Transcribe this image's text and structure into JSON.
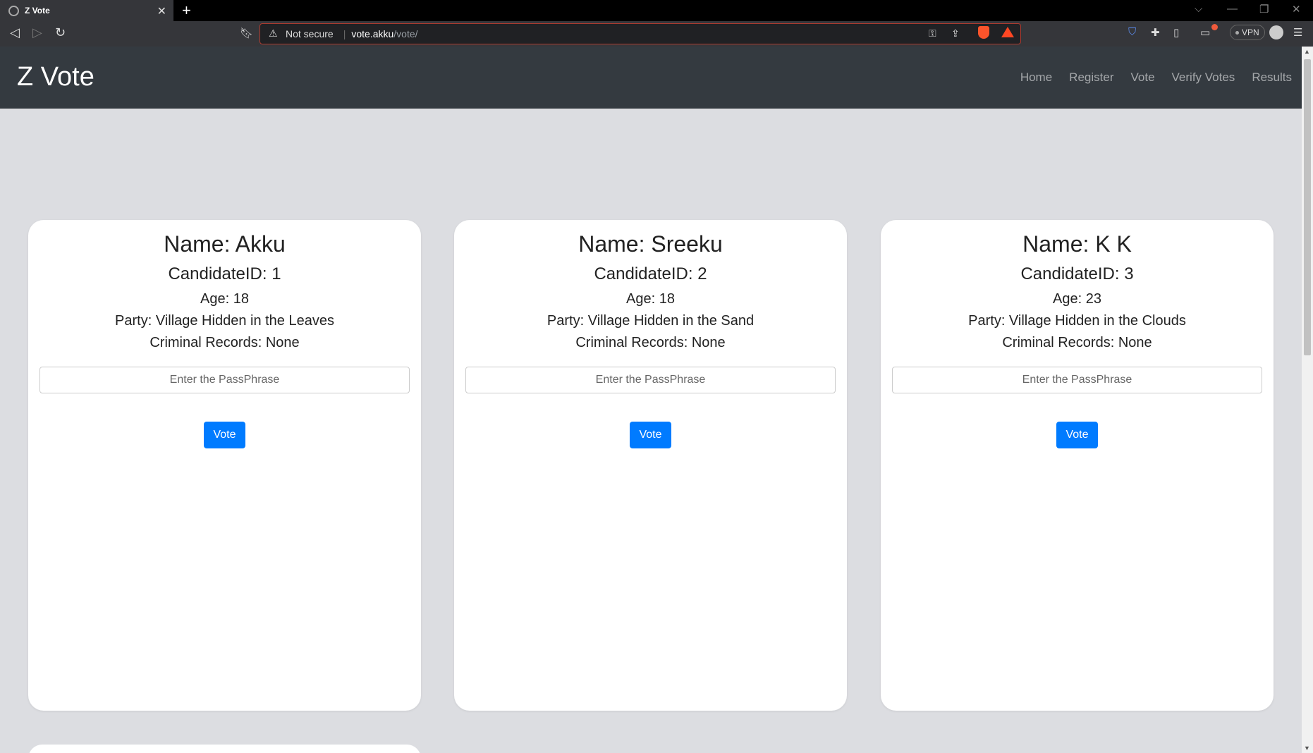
{
  "browser": {
    "tab_title": "Z Vote",
    "tab_close": "✕",
    "new_tab": "+",
    "omnibox": {
      "security": "Not secure",
      "host": "vote.akku",
      "path": "/vote/"
    },
    "vpn_label": "VPN"
  },
  "navbar": {
    "brand": "Z Vote",
    "links": [
      "Home",
      "Register",
      "Vote",
      "Verify Votes",
      "Results"
    ]
  },
  "candidates": [
    {
      "name": "Name: Akku",
      "id": "CandidateID: 1",
      "age": "Age: 18",
      "party": "Party: Village Hidden in the Leaves",
      "records": "Criminal Records: None",
      "placeholder": "Enter the PassPhrase",
      "button": "Vote"
    },
    {
      "name": "Name: Sreeku",
      "id": "CandidateID: 2",
      "age": "Age: 18",
      "party": "Party: Village Hidden in the Sand",
      "records": "Criminal Records: None",
      "placeholder": "Enter the PassPhrase",
      "button": "Vote"
    },
    {
      "name": "Name: K K",
      "id": "CandidateID: 3",
      "age": "Age: 23",
      "party": "Party: Village Hidden in the Clouds",
      "records": "Criminal Records: None",
      "placeholder": "Enter the PassPhrase",
      "button": "Vote"
    }
  ],
  "colors": {
    "navbar_bg": "#343a40",
    "page_bg": "#dcdde1",
    "primary": "#007bff"
  }
}
